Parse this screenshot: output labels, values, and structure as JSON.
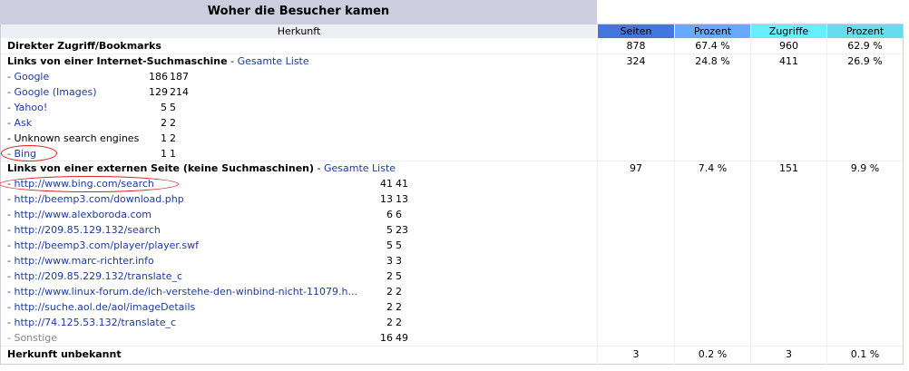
{
  "title": "Woher die Besucher kamen",
  "header": {
    "herkunft": "Herkunft",
    "seiten": "Seiten",
    "prozent1": "Prozent",
    "zugriffe": "Zugriffe",
    "prozent2": "Prozent"
  },
  "colors": {
    "title_bg": "#cccdde",
    "seiten_bg": "#4477dd",
    "prozent_bg": "#66aaff",
    "zugriffe_bg": "#66eeff",
    "zugriffe_pct_bg": "#66ddee",
    "link": "#1e3b9a",
    "highlight": "#e02020"
  },
  "direct": {
    "label": "Direkter Zugriff/Bookmarks",
    "seiten": "878",
    "prozent1": "67.4 %",
    "zugriffe": "960",
    "prozent2": "62.9 %"
  },
  "search_engines": {
    "label": "Links von einer Internet-Suchmaschine",
    "list_link": "Gesamte Liste",
    "seiten": "324",
    "prozent1": "24.8 %",
    "zugriffe": "411",
    "prozent2": "26.9 %",
    "items": [
      {
        "name": "- Google",
        "a": "186",
        "b": "187"
      },
      {
        "name": "- Google (Images)",
        "a": "129",
        "b": "214"
      },
      {
        "name": "- Yahoo!",
        "a": "5",
        "b": "5"
      },
      {
        "name": "- Ask",
        "a": "2",
        "b": "2"
      },
      {
        "name": "- Unknown search engines",
        "a": "1",
        "b": "2"
      },
      {
        "name": "- Bing",
        "a": "1",
        "b": "1"
      }
    ]
  },
  "external": {
    "label": "Links von einer externen Seite (keine Suchmaschinen)",
    "list_link": "Gesamte Liste",
    "seiten": "97",
    "prozent1": "7.4 %",
    "zugriffe": "151",
    "prozent2": "9.9 %",
    "items": [
      {
        "name": "- http://www.bing.com/search",
        "a": "41",
        "b": "41"
      },
      {
        "name": "- http://beemp3.com/download.php",
        "a": "13",
        "b": "13"
      },
      {
        "name": "- http://www.alexboroda.com",
        "a": "6",
        "b": "6"
      },
      {
        "name": "- http://209.85.129.132/search",
        "a": "5",
        "b": "23"
      },
      {
        "name": "- http://beemp3.com/player/player.swf",
        "a": "5",
        "b": "5"
      },
      {
        "name": "- http://www.marc-richter.info",
        "a": "3",
        "b": "3"
      },
      {
        "name": "- http://209.85.229.132/translate_c",
        "a": "2",
        "b": "5"
      },
      {
        "name": "- http://www.linux-forum.de/ich-verstehe-den-winbind-nicht-11079.h...",
        "a": "2",
        "b": "2"
      },
      {
        "name": "- http://suche.aol.de/aol/imageDetails",
        "a": "2",
        "b": "2"
      },
      {
        "name": "- http://74.125.53.132/translate_c",
        "a": "2",
        "b": "2"
      },
      {
        "name": "- Sonstige",
        "a": "16",
        "b": "49"
      }
    ]
  },
  "unknown": {
    "label": "Herkunft unbekannt",
    "seiten": "3",
    "prozent1": "0.2 %",
    "zugriffe": "3",
    "prozent2": "0.1 %"
  }
}
